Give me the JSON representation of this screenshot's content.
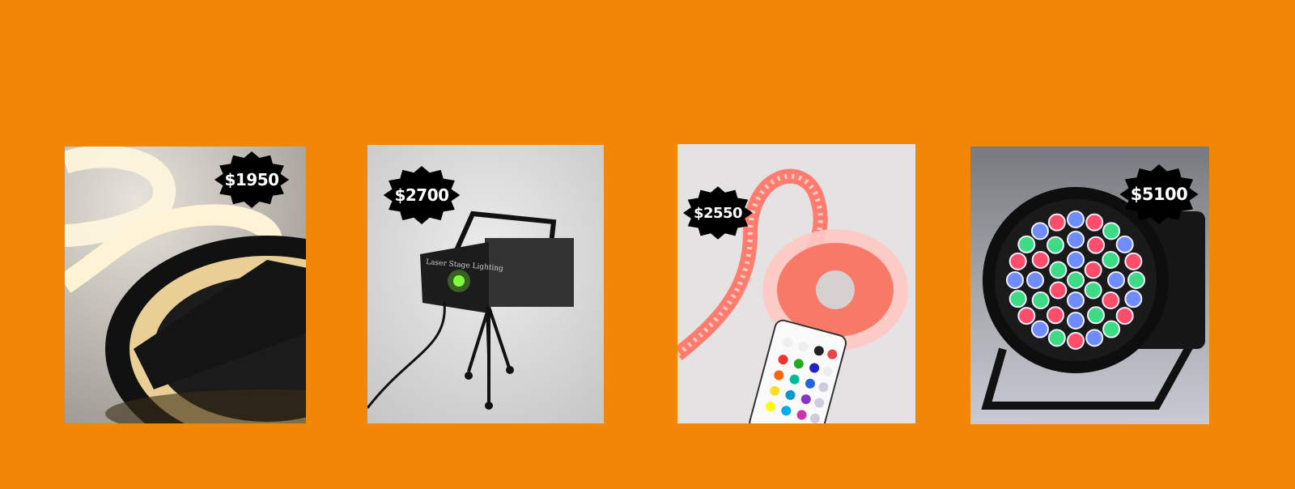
{
  "background_color": "#f28705",
  "products": [
    {
      "name": "warm-white-led-strip",
      "price": "$1950"
    },
    {
      "name": "laser-stage-light",
      "price": "$2700",
      "device_label": "Laser Stage Lighting"
    },
    {
      "name": "rgb-led-strip-with-remote",
      "price": "$2550"
    },
    {
      "name": "rgb-led-par-light",
      "price": "$5100"
    }
  ]
}
